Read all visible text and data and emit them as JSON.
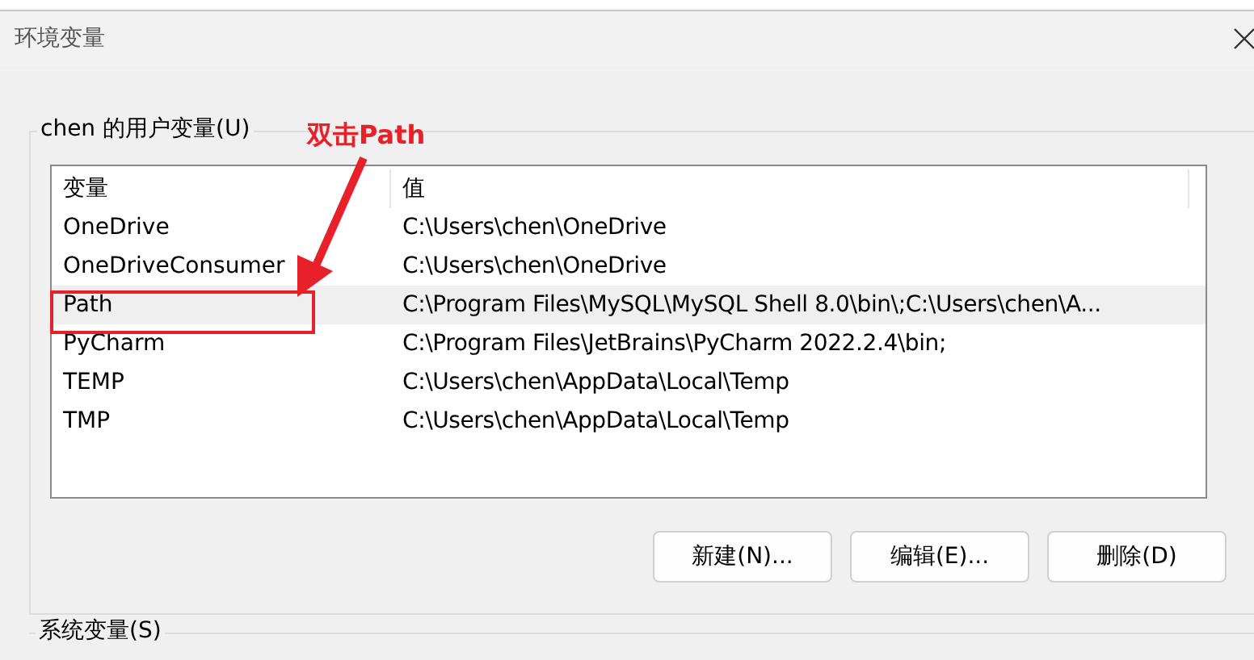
{
  "window": {
    "title": "环境变量"
  },
  "user_variables": {
    "label": "chen 的用户变量(U)",
    "columns": [
      "变量",
      "值"
    ],
    "rows": [
      {
        "name": "OneDrive",
        "value": "C:\\Users\\chen\\OneDrive",
        "selected": false
      },
      {
        "name": "OneDriveConsumer",
        "value": "C:\\Users\\chen\\OneDrive",
        "selected": false
      },
      {
        "name": "Path",
        "value": "C:\\Program Files\\MySQL\\MySQL Shell 8.0\\bin\\;C:\\Users\\chen\\A...",
        "selected": true
      },
      {
        "name": "PyCharm",
        "value": "C:\\Program Files\\JetBrains\\PyCharm 2022.2.4\\bin;",
        "selected": false
      },
      {
        "name": "TEMP",
        "value": "C:\\Users\\chen\\AppData\\Local\\Temp",
        "selected": false
      },
      {
        "name": "TMP",
        "value": "C:\\Users\\chen\\AppData\\Local\\Temp",
        "selected": false
      }
    ],
    "buttons": [
      "新建(N)...",
      "编辑(E)...",
      "删除(D)"
    ]
  },
  "annotation": {
    "text": "双击Path"
  },
  "system_variables": {
    "label": "系统变量(S)"
  }
}
